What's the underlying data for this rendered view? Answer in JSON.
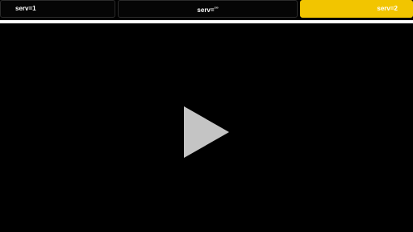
{
  "tabs": {
    "items": [
      {
        "label": "serv=1"
      },
      {
        "label": "serv=",
        "superscript": "²³³"
      },
      {
        "label": "serv=2"
      }
    ],
    "active_index": 2,
    "active_color": "#f2c500"
  },
  "player": {
    "background_color": "#000000",
    "play_icon": "play-icon",
    "play_icon_color": "#c4c4c4"
  }
}
